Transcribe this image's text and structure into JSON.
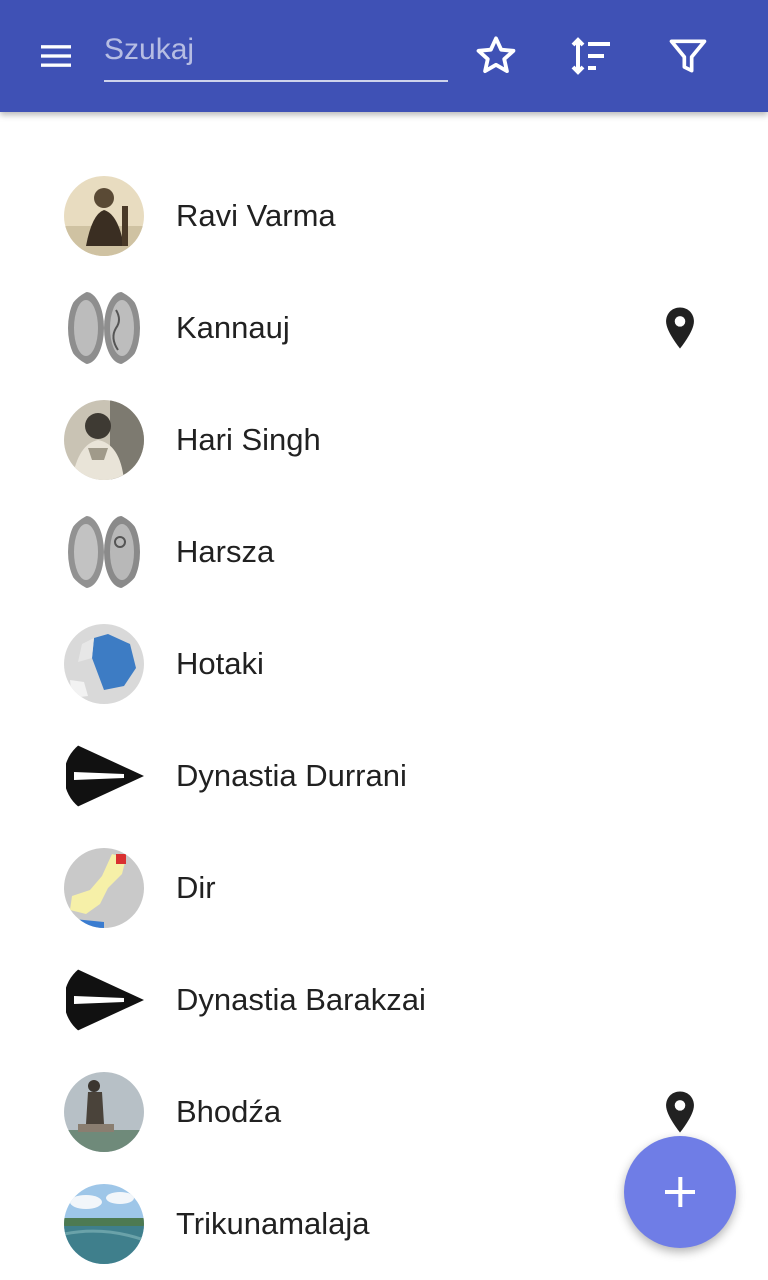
{
  "search": {
    "placeholder": "Szukaj",
    "value": ""
  },
  "toolbar": {
    "menu_icon": "menu-icon",
    "favorites_icon": "star-outline-icon",
    "sort_icon": "sort-icon",
    "filter_icon": "filter-icon"
  },
  "colors": {
    "appbar": "#3f51b5",
    "fab": "#6f7de6",
    "text": "#212121"
  },
  "items": [
    {
      "name": "Ravi Varma",
      "thumbnail": "portrait-photo",
      "has_location": false
    },
    {
      "name": "Kannauj",
      "thumbnail": "coin",
      "has_location": true
    },
    {
      "name": "Hari Singh",
      "thumbnail": "portrait-photo",
      "has_location": false
    },
    {
      "name": "Harsza",
      "thumbnail": "coin",
      "has_location": false
    },
    {
      "name": "Hotaki",
      "thumbnail": "map",
      "has_location": false
    },
    {
      "name": "Dynastia Durrani",
      "thumbnail": "flag",
      "has_location": false
    },
    {
      "name": "Dir",
      "thumbnail": "map",
      "has_location": false
    },
    {
      "name": "Dynastia Barakzai",
      "thumbnail": "flag",
      "has_location": false
    },
    {
      "name": "Bhodźa",
      "thumbnail": "statue-photo",
      "has_location": true
    },
    {
      "name": "Trikunamalaja",
      "thumbnail": "landscape-photo",
      "has_location": false
    }
  ],
  "fab": {
    "icon": "plus-icon"
  }
}
